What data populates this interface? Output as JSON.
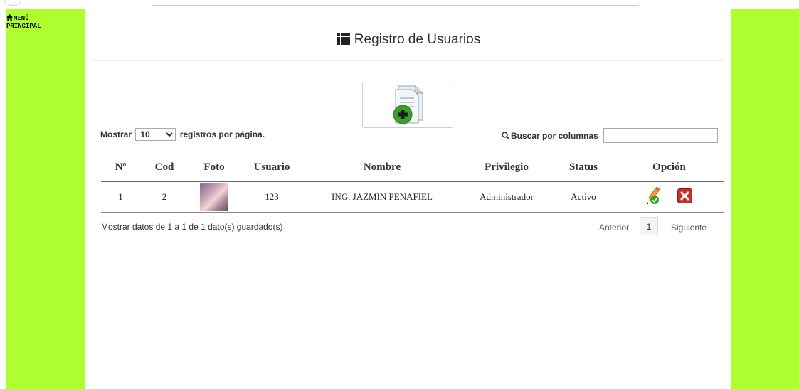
{
  "sidebar": {
    "menu_label_line1": "MENÚ",
    "menu_label_line2": "PRINCIPAL"
  },
  "header": {
    "title": "Registro de Usuarios"
  },
  "controls": {
    "show_label": "Mostrar",
    "page_length": "10",
    "records_label": "registros por página.",
    "search_label": "Buscar por columnas",
    "search_value": ""
  },
  "table": {
    "columns": [
      "Nº",
      "Cod",
      "Foto",
      "Usuario",
      "Nombre",
      "Privilegio",
      "Status",
      "Opción"
    ],
    "rows": [
      {
        "num": "1",
        "cod": "2",
        "usuario": "123",
        "nombre": "ING. JAZMIN PENAFIEL",
        "privilegio": "Administrador",
        "status": "Activo"
      }
    ]
  },
  "footer": {
    "info": "Mostrar datos de 1 a 1 de 1 dato(s) guardado(s)",
    "prev": "Anterior",
    "page": "1",
    "next": "Siguiente"
  },
  "colors": {
    "sidebar": "#adff2f",
    "delete": "#c9302c"
  }
}
